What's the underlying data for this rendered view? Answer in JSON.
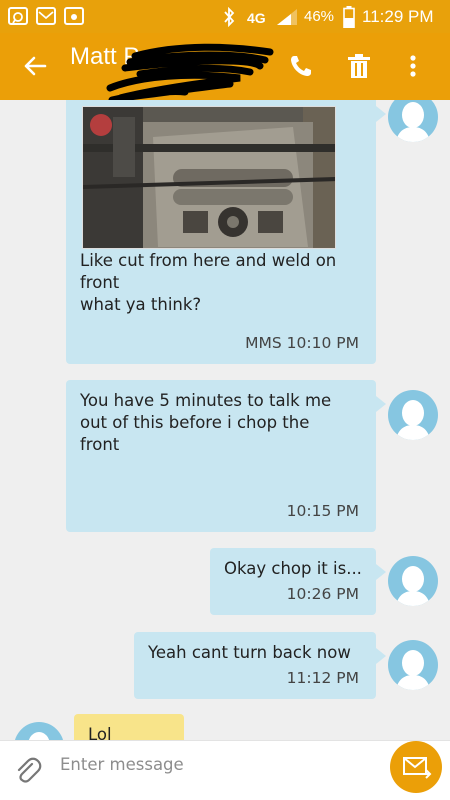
{
  "status_bar": {
    "network": "4G",
    "battery": "46%",
    "time": "11:29 PM"
  },
  "header": {
    "contact_name": "Matt P"
  },
  "messages": [
    {
      "direction": "outgoing",
      "has_image": true,
      "text": "Like cut from here and weld on\nfront\nwhat ya think?",
      "time": "MMS 10:10 PM"
    },
    {
      "direction": "outgoing",
      "text": "You have 5 minutes to talk me\nout of this before i chop the\nfront",
      "time": "10:15 PM"
    },
    {
      "direction": "outgoing",
      "text": "Okay chop it is...",
      "time": "10:26 PM"
    },
    {
      "direction": "outgoing",
      "text": "Yeah cant turn back now",
      "time": "11:12 PM"
    },
    {
      "direction": "incoming",
      "text": "Lol"
    }
  ],
  "composer": {
    "placeholder": "Enter message"
  },
  "colors": {
    "accent": "#eb9f08",
    "outgoing_bubble": "#c8e6f1",
    "incoming_bubble": "#f8e48a",
    "avatar": "#86c6e1"
  }
}
